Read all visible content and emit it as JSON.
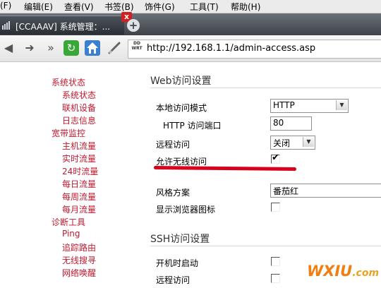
{
  "menu": {
    "items": [
      "(F)",
      "编辑(E)",
      "查看(V)",
      "书签(B)",
      "饰件(G)",
      "工具(T)",
      "帮助(H)"
    ]
  },
  "tab": {
    "title": "[CCAAAV] 系统管理：...",
    "close_glyph": "x",
    "newtab_glyph": "+"
  },
  "nav": {
    "back_glyph": "◀",
    "forward_glyph": "➜",
    "fastforward_glyph": "»",
    "refresh_glyph": "↻",
    "site_icon_text": "DD WRT",
    "address": "http://192.168.1.1/admin-access.asp"
  },
  "sidebar": {
    "status": "系统状态",
    "status_items": [
      "系统状态",
      "联机设备",
      "日志信息"
    ],
    "bandwidth": "宽带监控",
    "bandwidth_items": [
      "主机流量",
      "实时流量",
      "24时流量",
      "每日流量",
      "每周流量",
      "每月流量"
    ],
    "diag": "诊断工具",
    "diag_items": [
      "Ping",
      "追踪路由",
      "无线搜寻",
      "网络唤醒"
    ]
  },
  "web": {
    "section_title": "Web访问设置",
    "local_mode_label": "本地访问模式",
    "local_mode_value": "HTTP",
    "http_port_label": "HTTP 访问端口",
    "http_port_value": "80",
    "remote_label": "远程访问",
    "remote_value": "关闭",
    "wireless_label": "允许无线访问",
    "wireless_checked": true,
    "theme_label": "风格方案",
    "theme_value": "番茄红",
    "show_icon_label": "显示浏览器图标",
    "show_icon_checked": false
  },
  "ssh": {
    "section_title": "SSH访问设置",
    "boot_label": "开机时启动",
    "boot_checked": false,
    "remote_label": "远程访问",
    "remote_checked": false
  },
  "watermark": {
    "main": "WXIU",
    "suffix": ".com"
  },
  "colors": {
    "link_red": "#c0182e",
    "annotation_red": "#d8001b",
    "watermark_orange": "#f07e13"
  }
}
